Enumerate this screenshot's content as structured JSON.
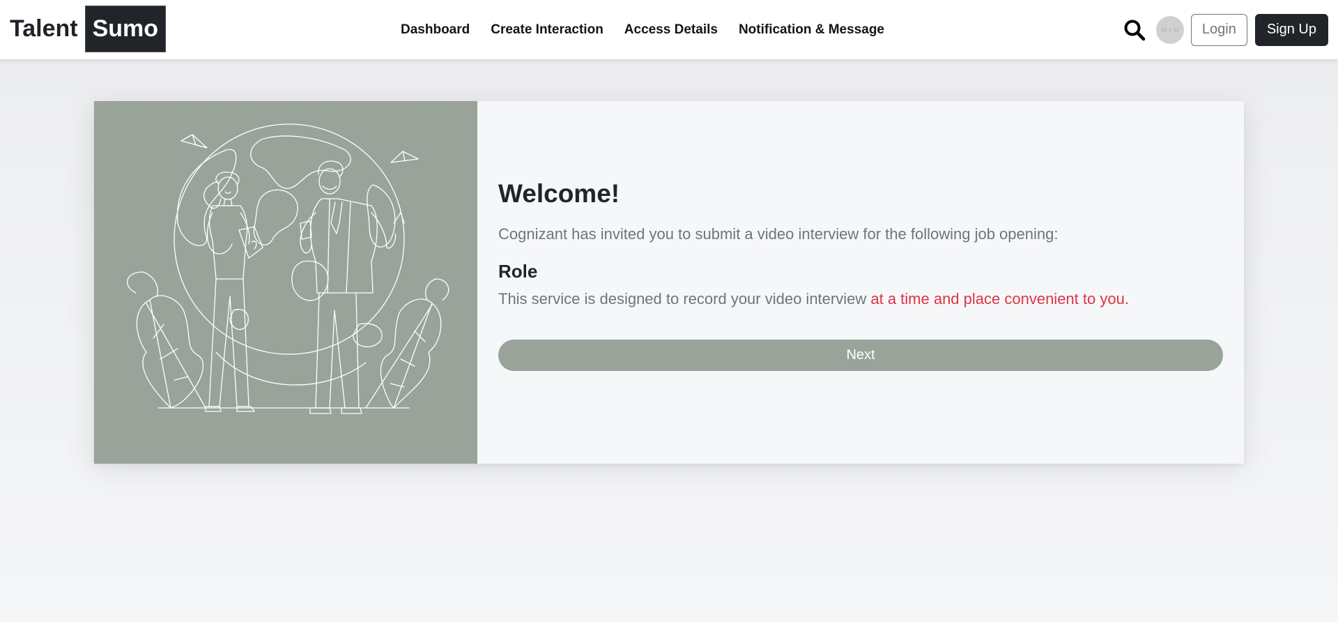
{
  "brand": {
    "left": "Talent",
    "right": "Sumo"
  },
  "nav": {
    "links": [
      {
        "label": "Dashboard"
      },
      {
        "label": "Create Interaction"
      },
      {
        "label": "Access Details"
      },
      {
        "label": "Notification & Message"
      }
    ],
    "search_icon": "search-icon",
    "avatar_text": "32 x 32",
    "login_label": "Login",
    "signup_label": "Sign Up"
  },
  "card": {
    "illustration": "two-people-globe-illustration",
    "title": "Welcome!",
    "invite_text": "Cognizant has invited you to submit a video interview for the following job opening:",
    "role_label": "Role",
    "service_text": "This service is designed to record your video interview ",
    "service_highlight": "at a time and place convenient to you.",
    "next_label": "Next"
  },
  "colors": {
    "accent_sage": "#99a39a",
    "dark": "#212529",
    "highlight_red": "#dc3545",
    "muted_text": "#6c757d"
  }
}
